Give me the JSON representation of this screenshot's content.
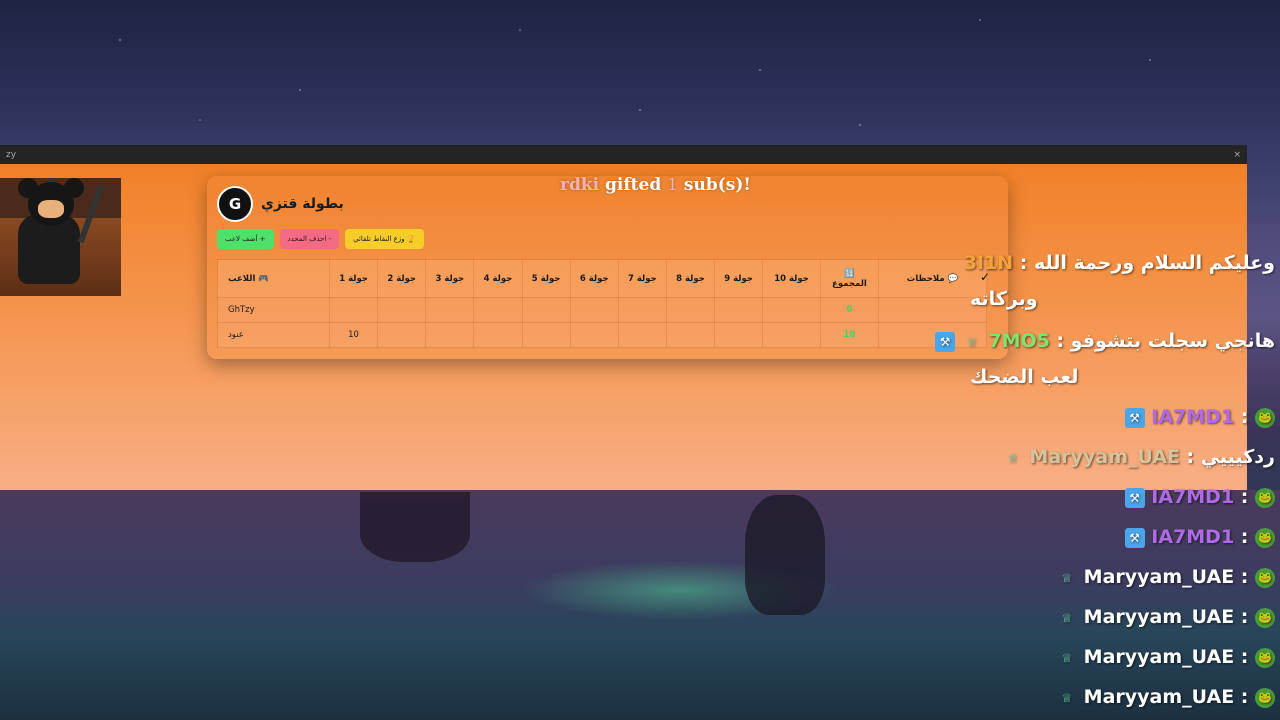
{
  "window": {
    "title_left": "zy",
    "close": "×"
  },
  "alert": {
    "user": "rdki",
    "verb": "gifted",
    "count": "1",
    "suffix": "sub(s)!"
  },
  "panel": {
    "logo_text": "G",
    "title": "بطولة قتزي",
    "buttons": {
      "add_player": "أضف لاعب +",
      "delete_selected": "احذف المحدد -",
      "distribute_points": "وزع النقاط تلقائي 🏆"
    },
    "table": {
      "headers": {
        "player": "اللاعب 🎮",
        "rounds": [
          "جولة 1",
          "جولة 2",
          "جولة 3",
          "جولة 4",
          "جولة 5",
          "جولة 6",
          "جولة 7",
          "جولة 8",
          "جولة 9",
          "جولة 10"
        ],
        "total": "المجموع",
        "total_icon": "🔢",
        "notes": "ملاحظات 💬"
      },
      "rows": [
        {
          "player": "GhTzy",
          "rounds": [
            "",
            "",
            "",
            "",
            "",
            "",
            "",
            "",
            "",
            ""
          ],
          "total": "0",
          "notes": ""
        },
        {
          "player": "عنود",
          "rounds": [
            "10",
            "",
            "",
            "",
            "",
            "",
            "",
            "",
            "",
            ""
          ],
          "total": "10",
          "notes": ""
        }
      ]
    }
  },
  "checkmark": "✓",
  "chat": {
    "messages": [
      {
        "user": "3I1N",
        "user_color": "#f4a23a",
        "text": "وعليكم السلام ورحمة الله",
        "cont": "وبركاته",
        "badges": []
      },
      {
        "user": "7MO5",
        "user_color": "#7ee36a",
        "text": "هانجي سجلت بتشوفو",
        "cont": "لعب الضحك",
        "badges": [
          "hammer",
          "sub"
        ]
      },
      {
        "user": "IA7MD1",
        "user_color": "#b06ae6",
        "text": "🐸",
        "cont": "",
        "badges": [
          "hammer"
        ]
      },
      {
        "user": "Maryyam_UAE",
        "user_color": "#d8c49a",
        "text": "ردكيييي",
        "cont": "",
        "badges": [
          "sub"
        ]
      },
      {
        "user": "IA7MD1",
        "user_color": "#b06ae6",
        "text": "🐸",
        "cont": "",
        "badges": [
          "hammer"
        ]
      },
      {
        "user": "IA7MD1",
        "user_color": "#b06ae6",
        "text": "🐸",
        "cont": "",
        "badges": [
          "hammer"
        ]
      },
      {
        "user": "Maryyam_UAE",
        "user_color": "#ffffff",
        "text": "🐸",
        "cont": "",
        "badges": [
          "sub"
        ]
      },
      {
        "user": "Maryyam_UAE",
        "user_color": "#ffffff",
        "text": "🐸",
        "cont": "",
        "badges": [
          "sub"
        ]
      },
      {
        "user": "Maryyam_UAE",
        "user_color": "#ffffff",
        "text": "🐸",
        "cont": "",
        "badges": [
          "sub"
        ]
      },
      {
        "user": "Maryyam_UAE",
        "user_color": "#ffffff",
        "text": "🐸",
        "cont": "",
        "badges": [
          "sub"
        ]
      }
    ]
  }
}
